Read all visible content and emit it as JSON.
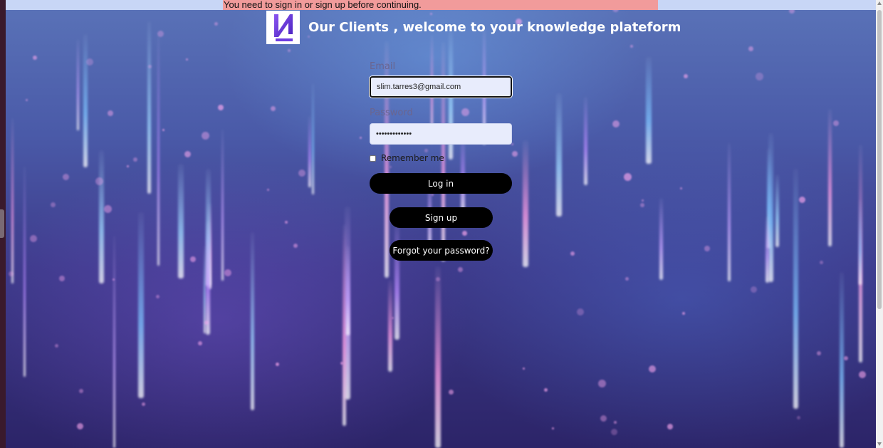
{
  "alert": {
    "message": "You need to sign in or sign up before continuing."
  },
  "header": {
    "logo_icon": "brand-logo-icon",
    "title": "Our Clients , welcome to your knowledge plateform"
  },
  "form": {
    "email_label": "Email",
    "email_value": "slim.tarres3@gmail.com",
    "password_label": "Password",
    "password_value": "•••••••••••••",
    "remember_label": "Remember me",
    "login_label": "Log in",
    "signup_label": "Sign up",
    "forgot_label": "Forgot your password?"
  },
  "colors": {
    "alert_bg": "#f19b9b",
    "topbar_bg": "#c8d6f6",
    "button_bg": "#000000",
    "input_bg": "#e8ecfc",
    "logo_purple": "#6d3be0"
  }
}
